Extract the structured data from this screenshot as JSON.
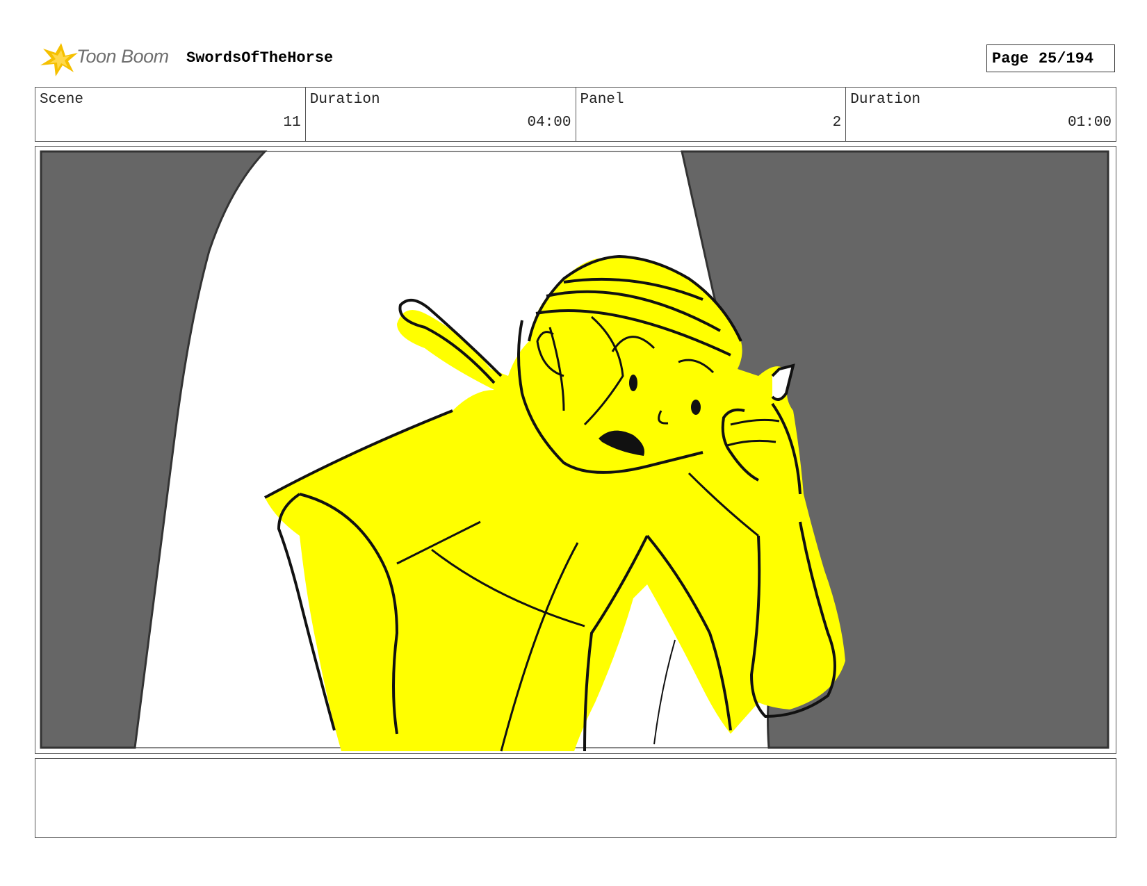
{
  "header": {
    "brand": "Toon Boom",
    "project_title": "SwordsOfTheHorse",
    "page_label": "Page",
    "page_number": "25/194"
  },
  "info": [
    {
      "label": "Scene",
      "value": "11"
    },
    {
      "label": "Duration",
      "value": "04:00"
    },
    {
      "label": "Panel",
      "value": "2"
    },
    {
      "label": "Duration",
      "value": "01:00"
    }
  ],
  "notes": "",
  "colors": {
    "curtain": "#666666",
    "character_fill": "#ffff00",
    "line": "#111111",
    "logo_accent": "#f5c000"
  }
}
